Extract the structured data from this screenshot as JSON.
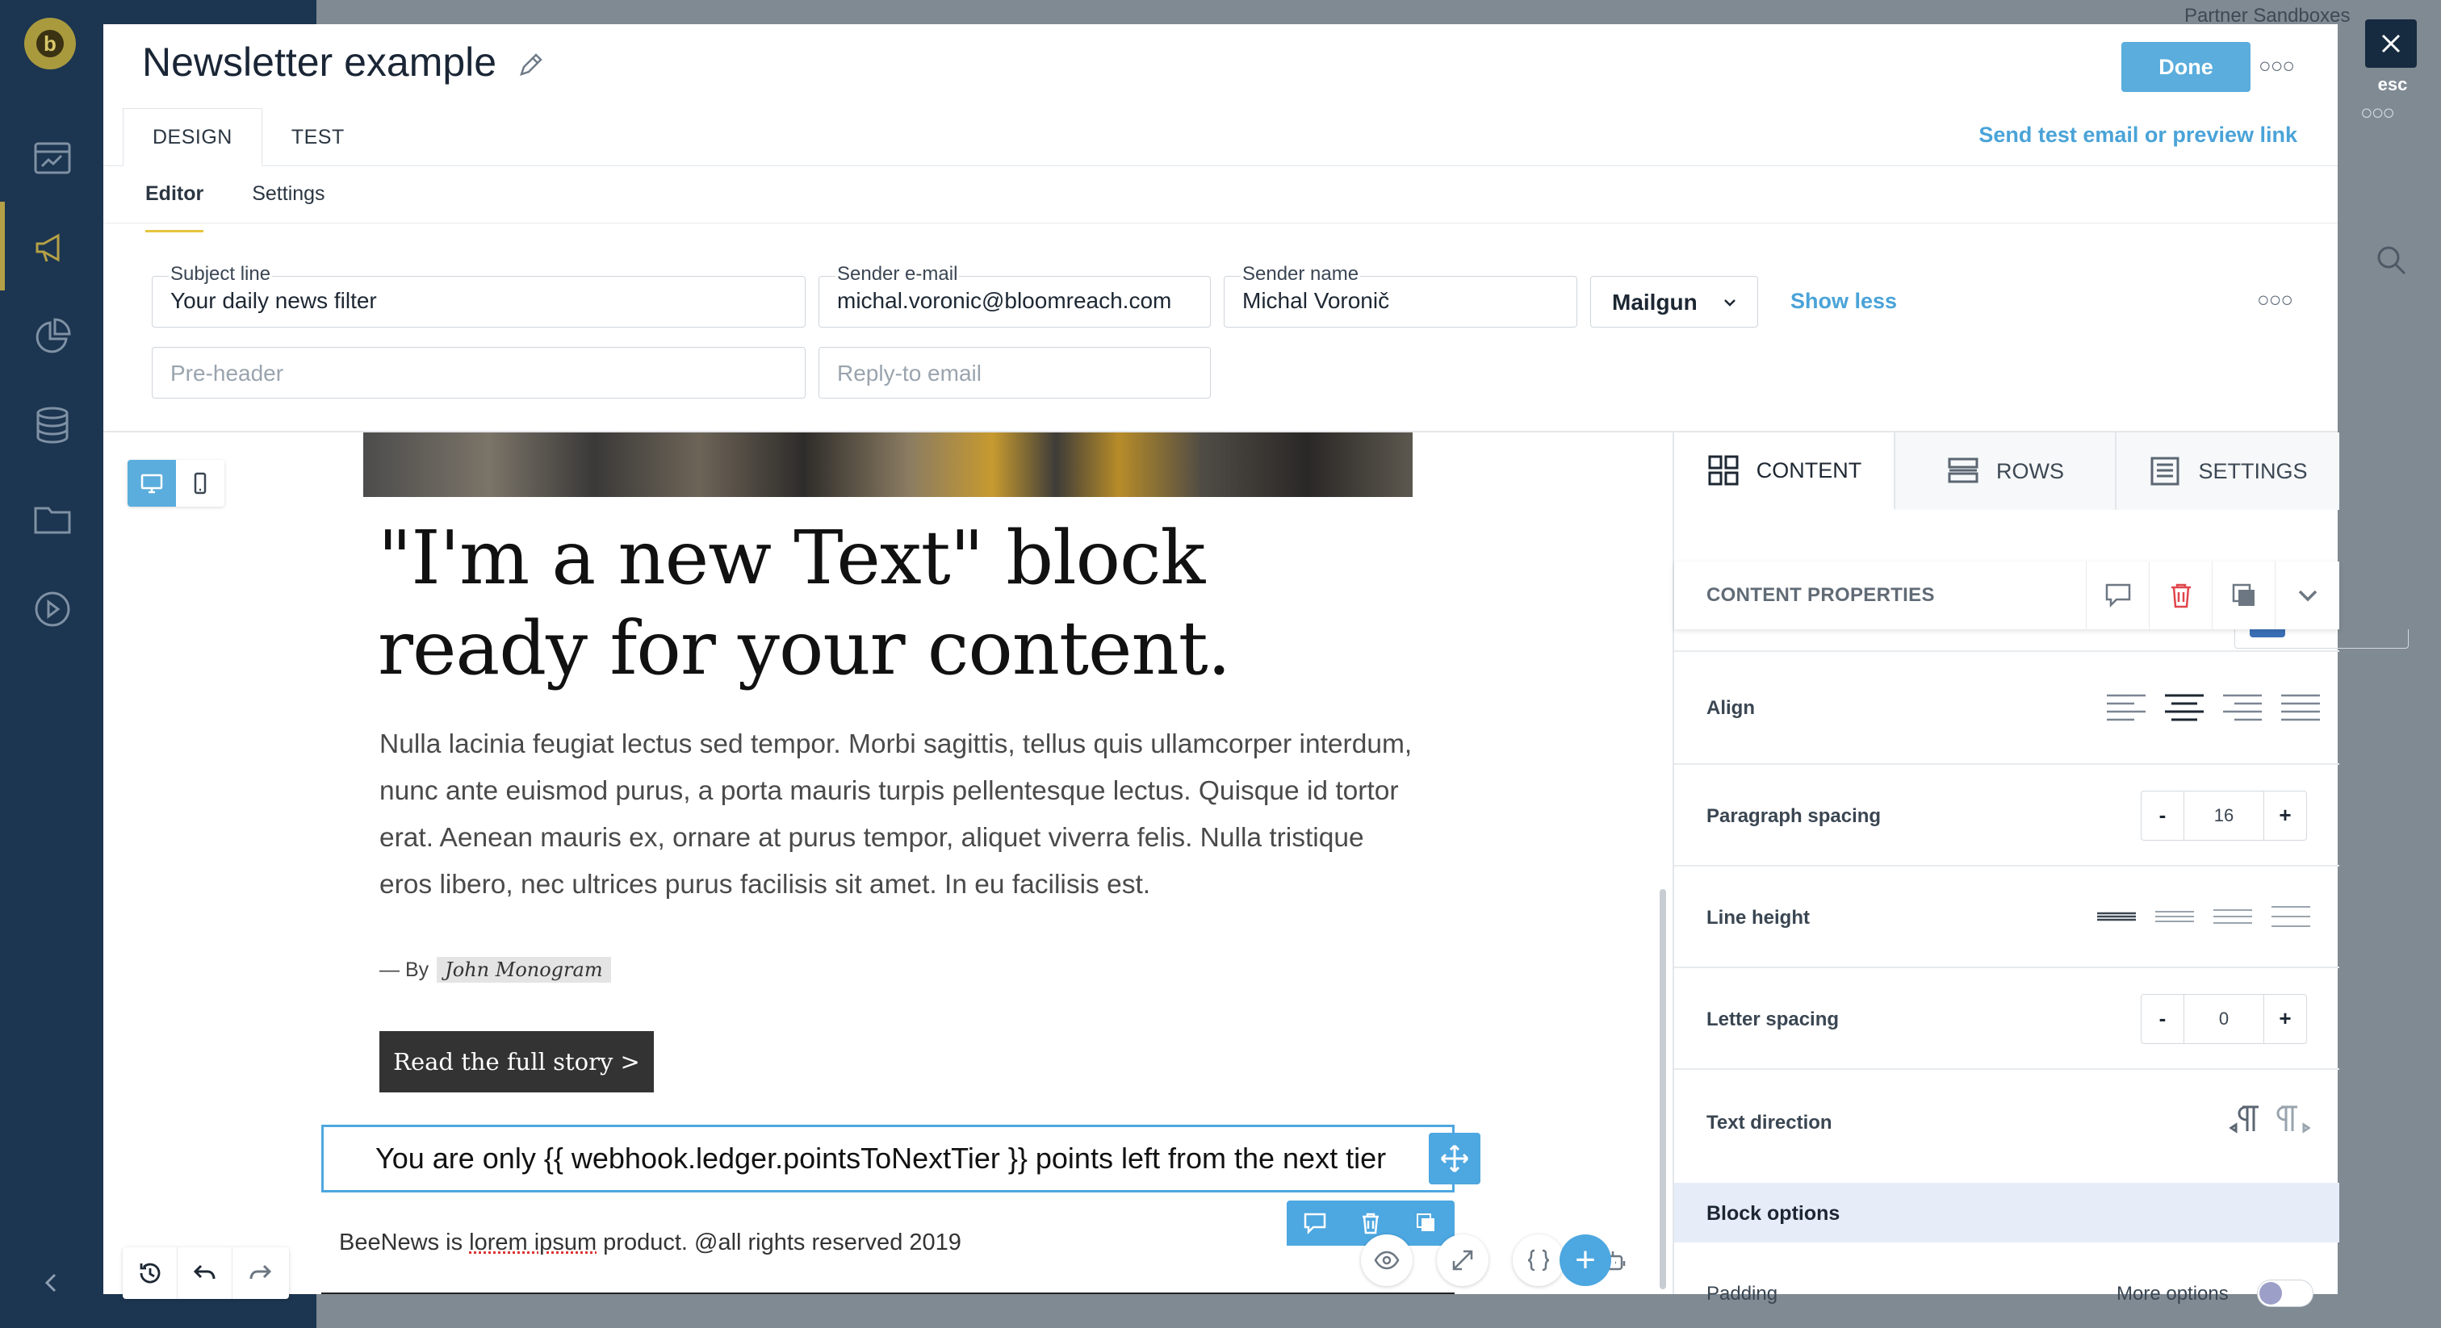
{
  "background_app": {
    "logo_letter": "b",
    "partner_label": "Partner Sandboxes",
    "nav_icons": [
      "dashboard-icon",
      "megaphone-icon",
      "analytics-icon",
      "database-icon",
      "folder-icon",
      "play-icon"
    ]
  },
  "close": {
    "esc_label": "esc"
  },
  "modal": {
    "title": "Newsletter example",
    "done_label": "Done",
    "tabs": [
      {
        "label": "DESIGN"
      },
      {
        "label": "TEST"
      }
    ],
    "send_test_link": "Send test email or preview link",
    "subtabs": [
      {
        "label": "Editor"
      },
      {
        "label": "Settings"
      }
    ]
  },
  "email_settings": {
    "subject": {
      "label": "Subject line",
      "value": "Your daily news filter"
    },
    "sender_email": {
      "label": "Sender e-mail",
      "value": "michal.voronic@bloomreach.com"
    },
    "sender_name": {
      "label": "Sender name",
      "value": "Michal Voronič"
    },
    "provider": "Mailgun",
    "show_less": "Show less",
    "preheader_placeholder": "Pre-header",
    "reply_to_placeholder": "Reply-to email"
  },
  "email_content": {
    "heading": "\"I'm a new Text\" block ready for your content.",
    "body": "Nulla lacinia feugiat lectus sed tempor. Morbi sagittis, tellus quis ullamcorper interdum, nunc ante euismod purus, a porta mauris turpis pellentesque lectus. Quisque id tortor erat. Aenean mauris ex, ornare at purus tempor, aliquet viverra felis. Nulla tristique eros libero, nec ultrices purus facilisis sit amet. In eu facilisis est.",
    "byline_prefix": "— By",
    "author": "John Monogram",
    "cta_label": "Read the full story >",
    "selected_text": "You are only {{ webhook.ledger.pointsToNextTier }} points left from the next tier",
    "footer_before": "BeeNews is ",
    "footer_underlined": "lorem ipsum",
    "footer_after": " product. @all rights reserved 2019",
    "add_label": "+"
  },
  "panel": {
    "tabs": [
      {
        "label": "CONTENT",
        "icon": "grid-icon"
      },
      {
        "label": "ROWS",
        "icon": "rows-icon"
      },
      {
        "label": "SETTINGS",
        "icon": "settings-doc-icon"
      }
    ],
    "props_title": "CONTENT PROPERTIES",
    "align_label": "Align",
    "paragraph_spacing": {
      "label": "Paragraph spacing",
      "value": "16",
      "minus": "-",
      "plus": "+"
    },
    "line_height_label": "Line height",
    "letter_spacing": {
      "label": "Letter spacing",
      "value": "0",
      "minus": "-",
      "plus": "+"
    },
    "text_direction_label": "Text direction",
    "block_options_label": "Block options",
    "padding_label": "Padding",
    "more_options_label": "More options",
    "more_options_enabled": false
  },
  "colors": {
    "accent": "#5aaddc",
    "selection": "#4da7e0",
    "sidebar": "#1c3550",
    "active_underline": "#e6c43d"
  }
}
